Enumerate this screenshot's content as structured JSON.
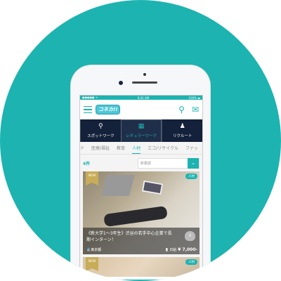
{
  "status": {
    "carrier": "●●●●● ᯤ",
    "time": "9:41 AM",
    "battery": "100% ▬"
  },
  "header": {
    "logo": "コネカ!!"
  },
  "tabs": [
    {
      "label": "スポットワーク",
      "icon": "pin-icon"
    },
    {
      "label": "レギュラーワーク",
      "icon": "calendar-icon"
    },
    {
      "label": "リクルート",
      "icon": "person-icon"
    }
  ],
  "categories": [
    "ド",
    "医療/福祉",
    "教育",
    "人材",
    "エコ/リサイクル",
    "ファッ"
  ],
  "count": "4件",
  "sort": {
    "value": "新着順"
  },
  "jobs": [
    {
      "badge": "NEW",
      "tag": "人材",
      "title": "《新大学1～3年生》渋谷の若手中心企業で長期インターン！",
      "likes": "0",
      "location": "東京都",
      "pay_label": "日給",
      "pay": "¥ 7,000-"
    },
    {
      "badge": "NEW",
      "tag": "人材"
    }
  ]
}
